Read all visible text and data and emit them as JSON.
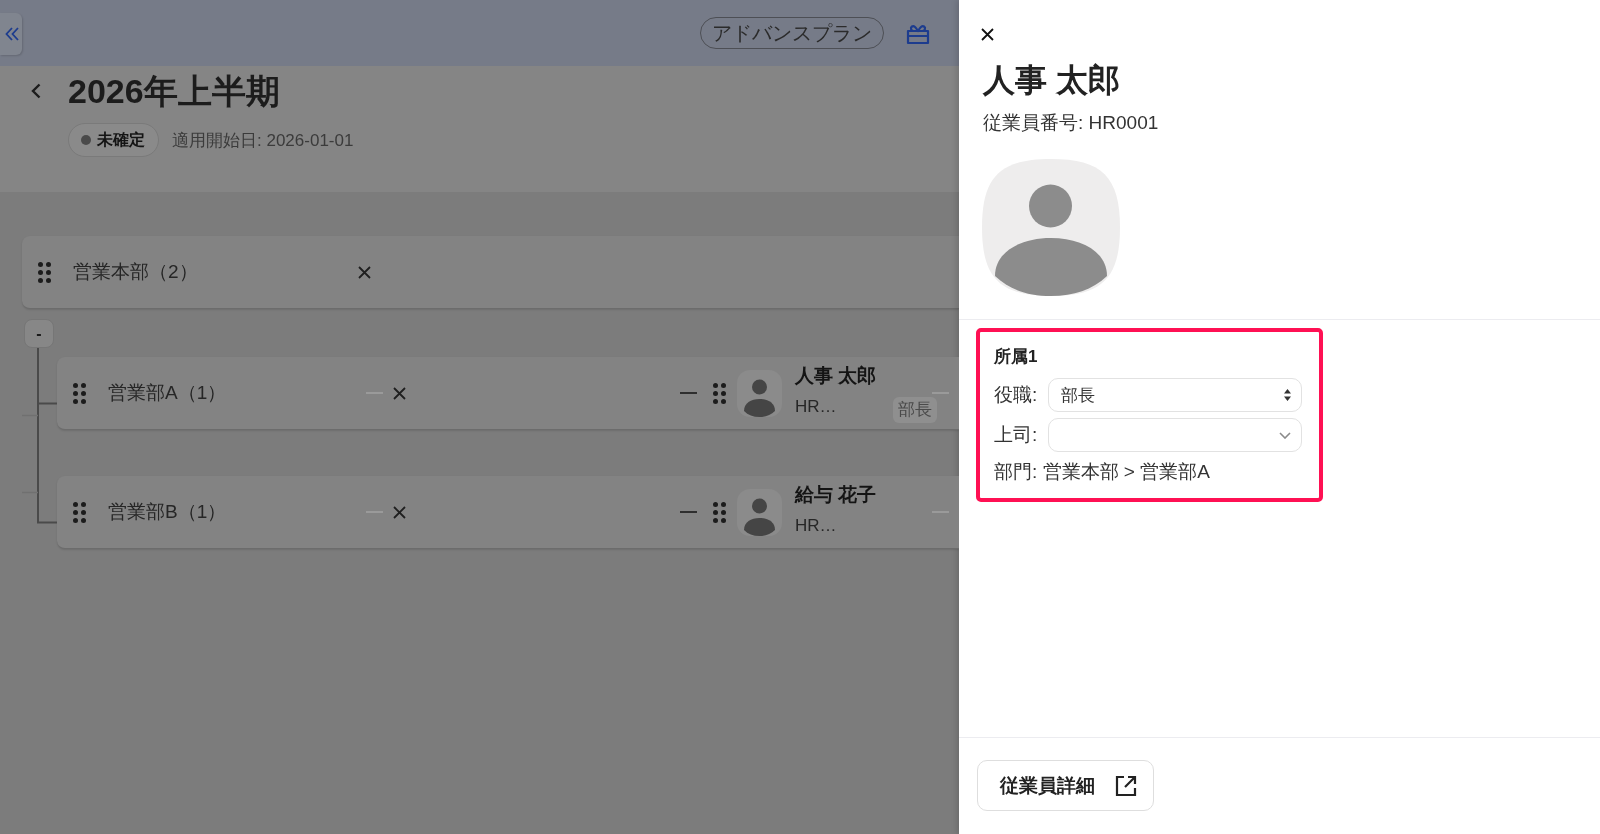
{
  "header": {
    "plan_badge": "アドバンスプラン"
  },
  "page": {
    "title": "2026年上半期",
    "status": "未確定",
    "start_date": "適用開始日: 2026-01-01"
  },
  "org_tree": {
    "label": "営業本部（2）",
    "expanded": true,
    "toggle": "-",
    "children": [
      {
        "label": "営業部A（1）",
        "employees": [
          {
            "name": "人事 太郎",
            "code": "HR…",
            "position": "部長"
          }
        ]
      },
      {
        "label": "営業部B（1）",
        "employees": [
          {
            "name": "給与 花子",
            "code": "HR…"
          }
        ]
      }
    ]
  },
  "drawer": {
    "title": "人事 太郎",
    "employee_number": "従業員番号: HR0001",
    "assignments": [
      {
        "title": "所属1",
        "highlighted": true,
        "fields": [
          {
            "kind": "select",
            "label": "役職:",
            "value": "部長"
          },
          {
            "kind": "combobox",
            "label": "上司:"
          }
        ],
        "department": "部門: 営業本部 > 営業部A"
      }
    ],
    "detail_button": "従業員詳細"
  }
}
